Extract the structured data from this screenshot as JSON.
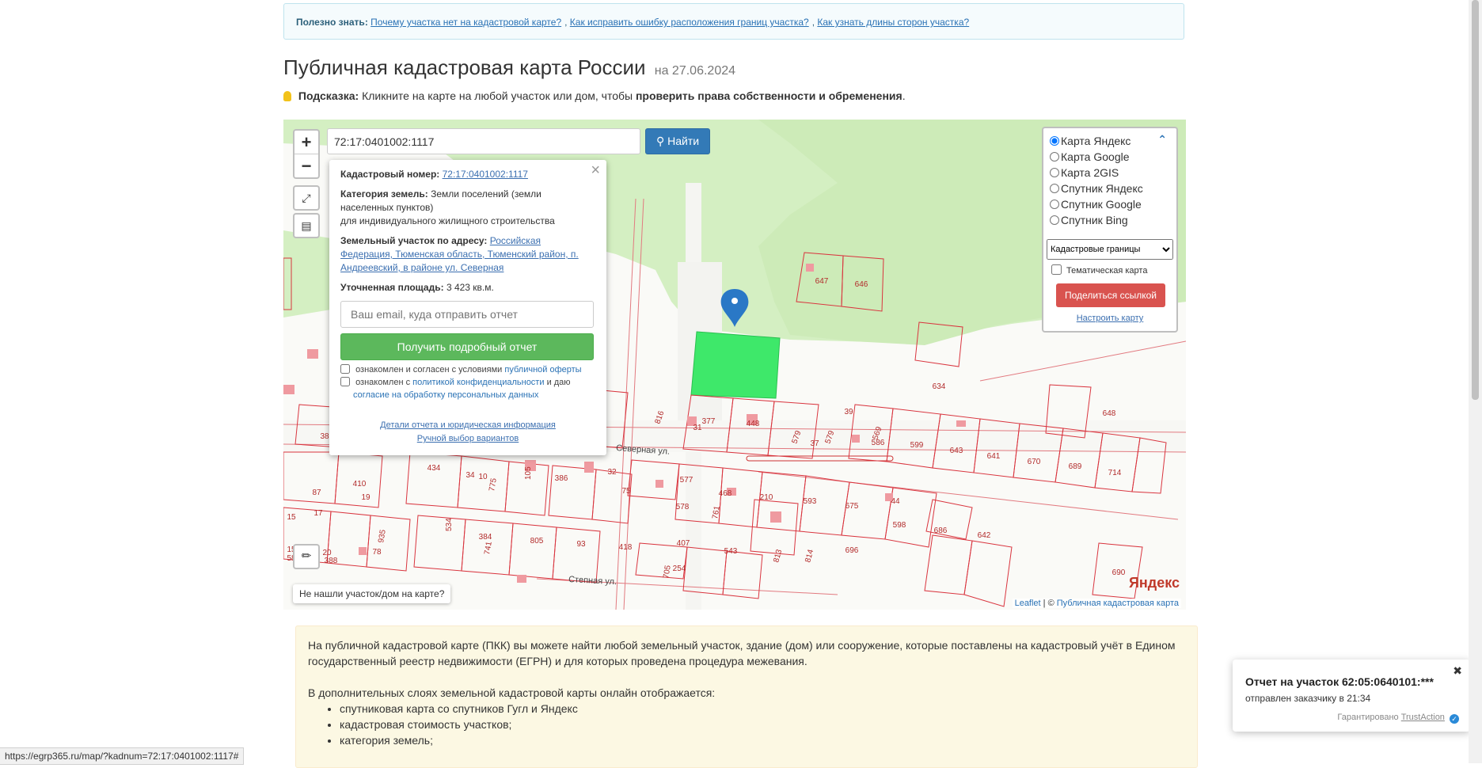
{
  "useful": {
    "label": "Полезно знать:",
    "links": [
      "Почему участка нет на кадастровой карте?",
      "Как исправить ошибку расположения границ участка?",
      "Как узнать длины сторон участка?"
    ]
  },
  "header": {
    "title": "Публичная кадастровая карта России",
    "date": "на 27.06.2024",
    "hint_label": "Подсказка:",
    "hint_text": "Кликните на карте на любой участок или дом, чтобы",
    "hint_bold": "проверить права собственности и обременения",
    "hint_end": "."
  },
  "map": {
    "zoom_in": "+",
    "zoom_out": "−",
    "search_value": "72:17:0401002:1117",
    "search_button": "Найти",
    "not_found": "Не нашли участок/дом на карте?",
    "yandex": "Яндекс",
    "attribution_leaflet": "Leaflet",
    "attribution_sep": " | © ",
    "attribution_pkk": "Публичная кадастровая карта",
    "street_labels": [
      "Северная ул.",
      "Степная ул."
    ],
    "parcel_numbers": [
      "647",
      "646",
      "634",
      "648",
      "569",
      "586",
      "599",
      "643",
      "641",
      "670",
      "689",
      "714",
      "377",
      "448",
      "579",
      "579",
      "351",
      "816",
      "39",
      "17",
      "34",
      "386",
      "75",
      "577",
      "468",
      "210",
      "593",
      "675",
      "44",
      "598",
      "686",
      "642",
      "690",
      "578",
      "407",
      "543",
      "814",
      "813",
      "696",
      "254",
      "384",
      "805",
      "93",
      "418",
      "534",
      "87",
      "410",
      "38",
      "388",
      "78",
      "15",
      "17",
      "19",
      "434",
      "10",
      "20",
      "58",
      "31",
      "37",
      "32",
      "23",
      "37",
      "576",
      "105",
      "935",
      "164",
      "705",
      "741",
      "261"
    ]
  },
  "popup": {
    "cadnum_label": "Кадастровый номер:",
    "cadnum_value": "72:17:0401002:1117",
    "category_label": "Категория земель:",
    "category_value": "Земли поселений (земли населенных пунктов)",
    "category_use": "для индивидуального жилищного строительства",
    "address_label": "Земельный участок по адресу:",
    "address_value": "Российская Федерация, Тюменская область, Тюменский район, п. Андреевский, в районе ул. Северная",
    "area_label": "Уточненная площадь:",
    "area_value": "3 423 кв.м.",
    "email_placeholder": "Ваш email, куда отправить отчет",
    "report_button": "Получить подробный отчет",
    "check1_text": "ознакомлен и согласен с условиями",
    "check1_link": "публичной оферты",
    "check2_text": "ознакомлен с",
    "check2_link1": "политикой конфиденциальности",
    "check2_mid": "и даю",
    "check2_link2": "согласие на обработку персональных данных",
    "details_link": "Детали отчета и юридическая информация",
    "manual_link": "Ручной выбор вариантов"
  },
  "layers": {
    "options": [
      "Карта Яндекс",
      "Карта Google",
      "Карта 2GIS",
      "Спутник Яндекс",
      "Спутник Google",
      "Спутник Bing"
    ],
    "selected": "Карта Яндекс",
    "select_value": "Кадастровые границы",
    "thematic": "Тематическая карта",
    "share_button": "Поделиться ссылкой",
    "setup_link": "Настроить карту"
  },
  "info": {
    "para1": "На публичной кадастровой карте (ПКК) вы можете найти любой земельный участок, здание (дом) или сооружение, которые поставлены на кадастровый учёт в Едином государственный реестр недвижимости (ЕГРН) и для которых проведена процедура межевания.",
    "para2": "В дополнительных слоях земельной кадастровой карты онлайн отображается:",
    "items": [
      "спутниковая карта со спутников Гугл и Яндекс",
      "кадастровая стоимость участков;",
      "категория земель;"
    ]
  },
  "toast": {
    "title": "Отчет на участок 62:05:0640101:***",
    "subtitle": "отправлен заказчику в 21:34",
    "footer": "Гарантировано",
    "footer_link": "TrustAction"
  },
  "status_url": "https://egrp365.ru/map/?kadnum=72:17:0401002:1117#",
  "colors": {
    "accent_blue": "#337ab7",
    "green": "#5cb85c",
    "red": "#d9534f",
    "selected_parcel": "#3ee86a",
    "parcel_border": "#d9343e"
  }
}
